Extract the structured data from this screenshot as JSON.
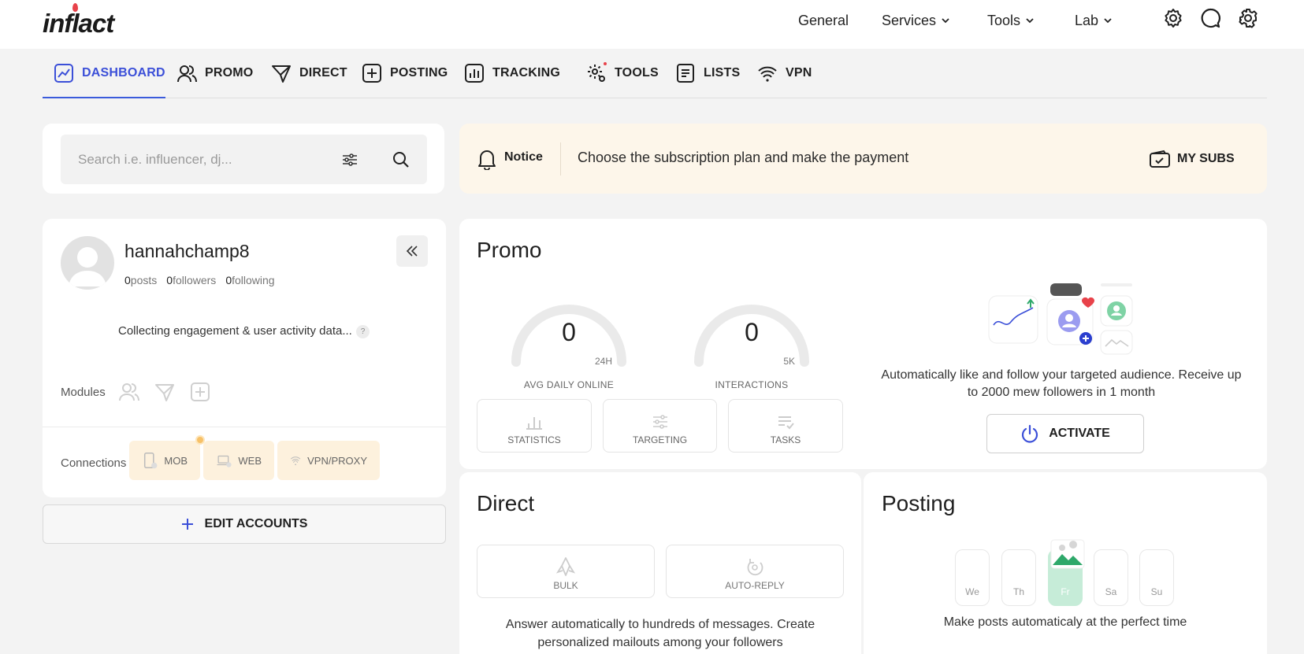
{
  "brand": {
    "logo_text": "inflact"
  },
  "top_nav": {
    "items": [
      {
        "label": "General",
        "has_dropdown": false
      },
      {
        "label": "Services",
        "has_dropdown": true
      },
      {
        "label": "Tools",
        "has_dropdown": true
      },
      {
        "label": "Lab",
        "has_dropdown": true
      }
    ],
    "icons": [
      "settings-icon",
      "chat-icon",
      "gear-icon"
    ]
  },
  "tabs": [
    {
      "label": "DASHBOARD",
      "icon": "chart-line-icon",
      "active": true
    },
    {
      "label": "PROMO",
      "icon": "users-icon",
      "active": false
    },
    {
      "label": "DIRECT",
      "icon": "send-icon",
      "active": false
    },
    {
      "label": "POSTING",
      "icon": "plus-square-icon",
      "active": false
    },
    {
      "label": "TRACKING",
      "icon": "bar-chart-icon",
      "active": false,
      "has_dot": true
    },
    {
      "label": "TOOLS",
      "icon": "cog-icon",
      "active": false
    },
    {
      "label": "LISTS",
      "icon": "list-icon",
      "active": false
    },
    {
      "label": "VPN",
      "icon": "wifi-icon",
      "active": false
    }
  ],
  "search": {
    "placeholder": "Search i.e. influencer, dj..."
  },
  "notice": {
    "label": "Notice",
    "text": "Choose the subscription plan and make the payment",
    "button": "MY SUBS"
  },
  "profile": {
    "username": "hannahchamp8",
    "posts_count": "0",
    "posts_label": "posts",
    "followers_count": "0",
    "followers_label": "followers",
    "following_count": "0",
    "following_label": "following",
    "status_text": "Collecting engagement & user activity data...",
    "help_mark": "?",
    "modules_label": "Modules",
    "connections_label": "Connections",
    "connections": [
      {
        "label": "MOB",
        "icon": "mobile-icon"
      },
      {
        "label": "WEB",
        "icon": "laptop-icon"
      },
      {
        "label": "VPN/PROXY",
        "icon": "wifi-icon"
      }
    ]
  },
  "edit_accounts": {
    "label": "EDIT ACCOUNTS"
  },
  "promo": {
    "title": "Promo",
    "gauges": [
      {
        "value": "0",
        "max": "24H",
        "label": "AVG DAILY ONLINE"
      },
      {
        "value": "0",
        "max": "5K",
        "label": "INTERACTIONS"
      }
    ],
    "buttons": [
      {
        "label": "STATISTICS",
        "icon": "bar-chart-icon"
      },
      {
        "label": "TARGETING",
        "icon": "sliders-icon"
      },
      {
        "label": "TASKS",
        "icon": "checklist-icon"
      }
    ],
    "description": "Automatically like and follow your targeted audience. Receive up to 2000 mew followers in 1 month",
    "activate_label": "ACTIVATE"
  },
  "direct": {
    "title": "Direct",
    "buttons": [
      {
        "label": "BULK",
        "icon": "rocket-icon"
      },
      {
        "label": "AUTO-REPLY",
        "icon": "reply-icon"
      }
    ],
    "description": "Answer automatically to hundreds of messages. Create personalized mailouts among your followers"
  },
  "posting": {
    "title": "Posting",
    "days": [
      "We",
      "Th",
      "Fr",
      "Sa",
      "Su"
    ],
    "active_day": "Fr",
    "description": "Make posts automaticaly at the perfect time"
  },
  "colors": {
    "accent": "#3b4fd8",
    "notice_bg": "#fdf6ea",
    "brand_red": "#e8424a",
    "active_day": "#c6ecd8"
  }
}
